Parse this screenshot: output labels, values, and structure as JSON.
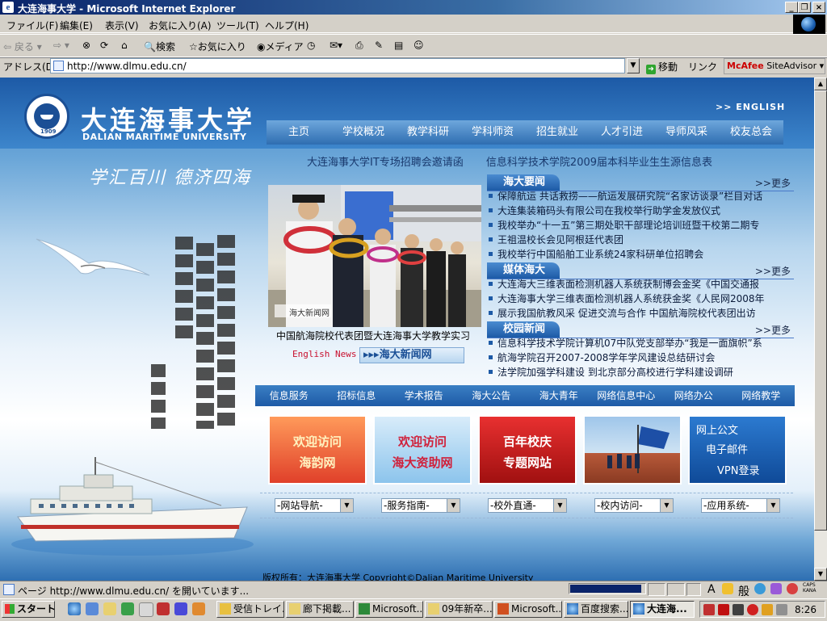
{
  "window": {
    "title": "大连海事大学 - Microsoft Internet Explorer",
    "controls": [
      "_",
      "❐",
      "×"
    ]
  },
  "menu": [
    "ファイル(F)",
    "編集(E)",
    "表示(V)",
    "お気に入り(A)",
    "ツール(T)",
    "ヘルプ(H)"
  ],
  "toolbar": {
    "back": "戻る",
    "search": "検索",
    "favorites": "お気に入り",
    "media": "メディア"
  },
  "address": {
    "label": "アドレス(D)",
    "url": "http://www.dlmu.edu.cn/",
    "go": "移動",
    "links": "リンク",
    "mcafee_brand": "McAfee",
    "mcafee_product": "SiteAdvisor"
  },
  "site": {
    "name_cn": "大连海事大学",
    "name_en": "DALIAN MARITIME UNIVERSITY",
    "seal_year": "1909",
    "english_link": ">>  ENGLISH",
    "motto": "学汇百川  德济四海",
    "main_nav": [
      "主页",
      "学校概况",
      "教学科研",
      "学科师资",
      "招生就业",
      "人才引进",
      "导师风采",
      "校友总会"
    ],
    "marquee": [
      "大连海事大学IT专场招聘会邀请函",
      "信息科学技术学院2009届本科毕业生生源信息表"
    ],
    "photo_watermark": "海大新闻网",
    "photo_caption": "中国航海院校代表团暨大连海事大学教学实习",
    "english_news": "English News",
    "campus_news_button": "▸▸▸海大新闻网",
    "more_label": ">>更多",
    "news_sections": [
      {
        "title": "海大要闻",
        "items": [
          "保障航运 共话救捞——航运发展研究院“名家访谈录”栏目对话",
          "大连集装箱码头有限公司在我校举行助学金发放仪式",
          "我校举办“十一五”第三期处职干部理论培训班暨干校第二期专",
          "王祖温校长会见阿根廷代表团",
          "我校举行中国船舶工业系统24家科研单位招聘会"
        ]
      },
      {
        "title": "媒体海大",
        "items": [
          "大连海大三维表面检测机器人系统获制博会金奖《中国交通报",
          "大连海事大学三维表面检测机器人系统获金奖《人民网2008年",
          "展示我国航教风采 促进交流与合作 中国航海院校代表团出访"
        ]
      },
      {
        "title": "校园新闻",
        "items": [
          "信息科学技术学院计算机07中队党支部举办“我是一面旗帜”系",
          "航海学院召开2007-2008学年学风建设总结研讨会",
          "法学院加强学科建设 到北京部分高校进行学科建设调研"
        ]
      }
    ],
    "sub_nav": [
      "信息服务",
      "招标信息",
      "学术报告",
      "海大公告",
      "海大青年",
      "网络信息中心",
      "网络办公",
      "网络教学"
    ],
    "banners": [
      {
        "line1": "欢迎访问",
        "line2": "海韵网"
      },
      {
        "line1": "欢迎访问",
        "line2": "海大资助网"
      },
      {
        "line1": "百年校庆",
        "line2": "专题网站"
      },
      {
        "line1": "",
        "line2": ""
      },
      {
        "line1": "网上公文",
        "line2": "电子邮件",
        "line3": "VPN登录"
      }
    ],
    "dropdowns": [
      "-网站导航-",
      "-服务指南-",
      "-校外直通-",
      "-校内访问-",
      "-应用系统-"
    ],
    "copyright": "版权所有：大连海事大学 Copyright©Dalian Maritime University"
  },
  "status": {
    "text": "ページ http://www.dlmu.edu.cn/ を開いています...",
    "progress": 0.96,
    "ime": [
      "A",
      "般",
      "CAPS KANA"
    ]
  },
  "taskbar": {
    "start": "スタート",
    "tasks": [
      "受信トレイ...",
      "廊下掲載...",
      "Microsoft...",
      "09年新卒...",
      "Microsoft...",
      "百度搜索...",
      "大连海..."
    ],
    "clock": "8:26"
  },
  "colors": {
    "title_start": "#0a246a",
    "site_blue": "#1d5aa6",
    "nav_blue": "#2e6db1"
  }
}
